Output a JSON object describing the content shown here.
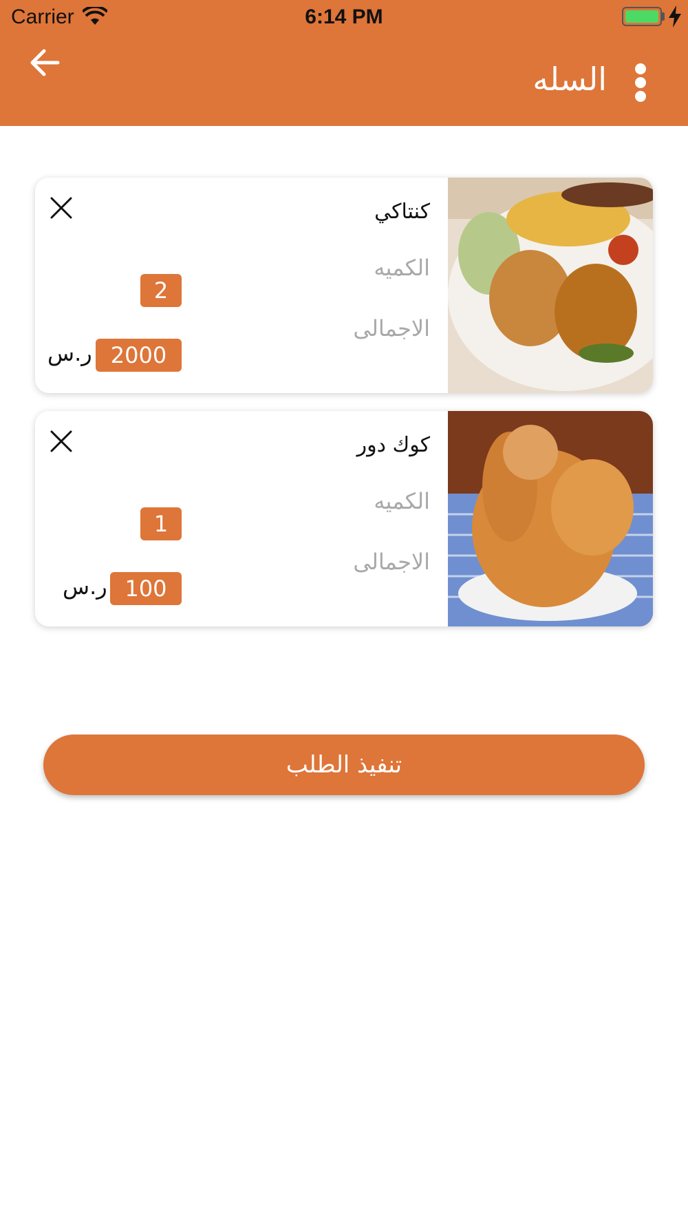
{
  "status_bar": {
    "carrier": "Carrier",
    "time": "6:14 PM",
    "battery_color": "#4CD964"
  },
  "header": {
    "title": "السله",
    "back_icon": "arrow-left-icon",
    "menu_icon": "more-vertical-icon",
    "background": "#DE7539"
  },
  "cart": {
    "items": [
      {
        "name": "كنتاكي",
        "qty_label": "الكميه",
        "qty": "2",
        "total_label": "الاجمالى",
        "total": "2000",
        "currency": "ر.س",
        "image": "grilled-chicken-plate-photo"
      },
      {
        "name": "كوك دور",
        "qty_label": "الكميه",
        "qty": "1",
        "total_label": "الاجمالى",
        "total": "100",
        "currency": "ر.س",
        "image": "fried-chicken-photo"
      }
    ]
  },
  "checkout": {
    "label": "تنفيذ الطلب"
  }
}
